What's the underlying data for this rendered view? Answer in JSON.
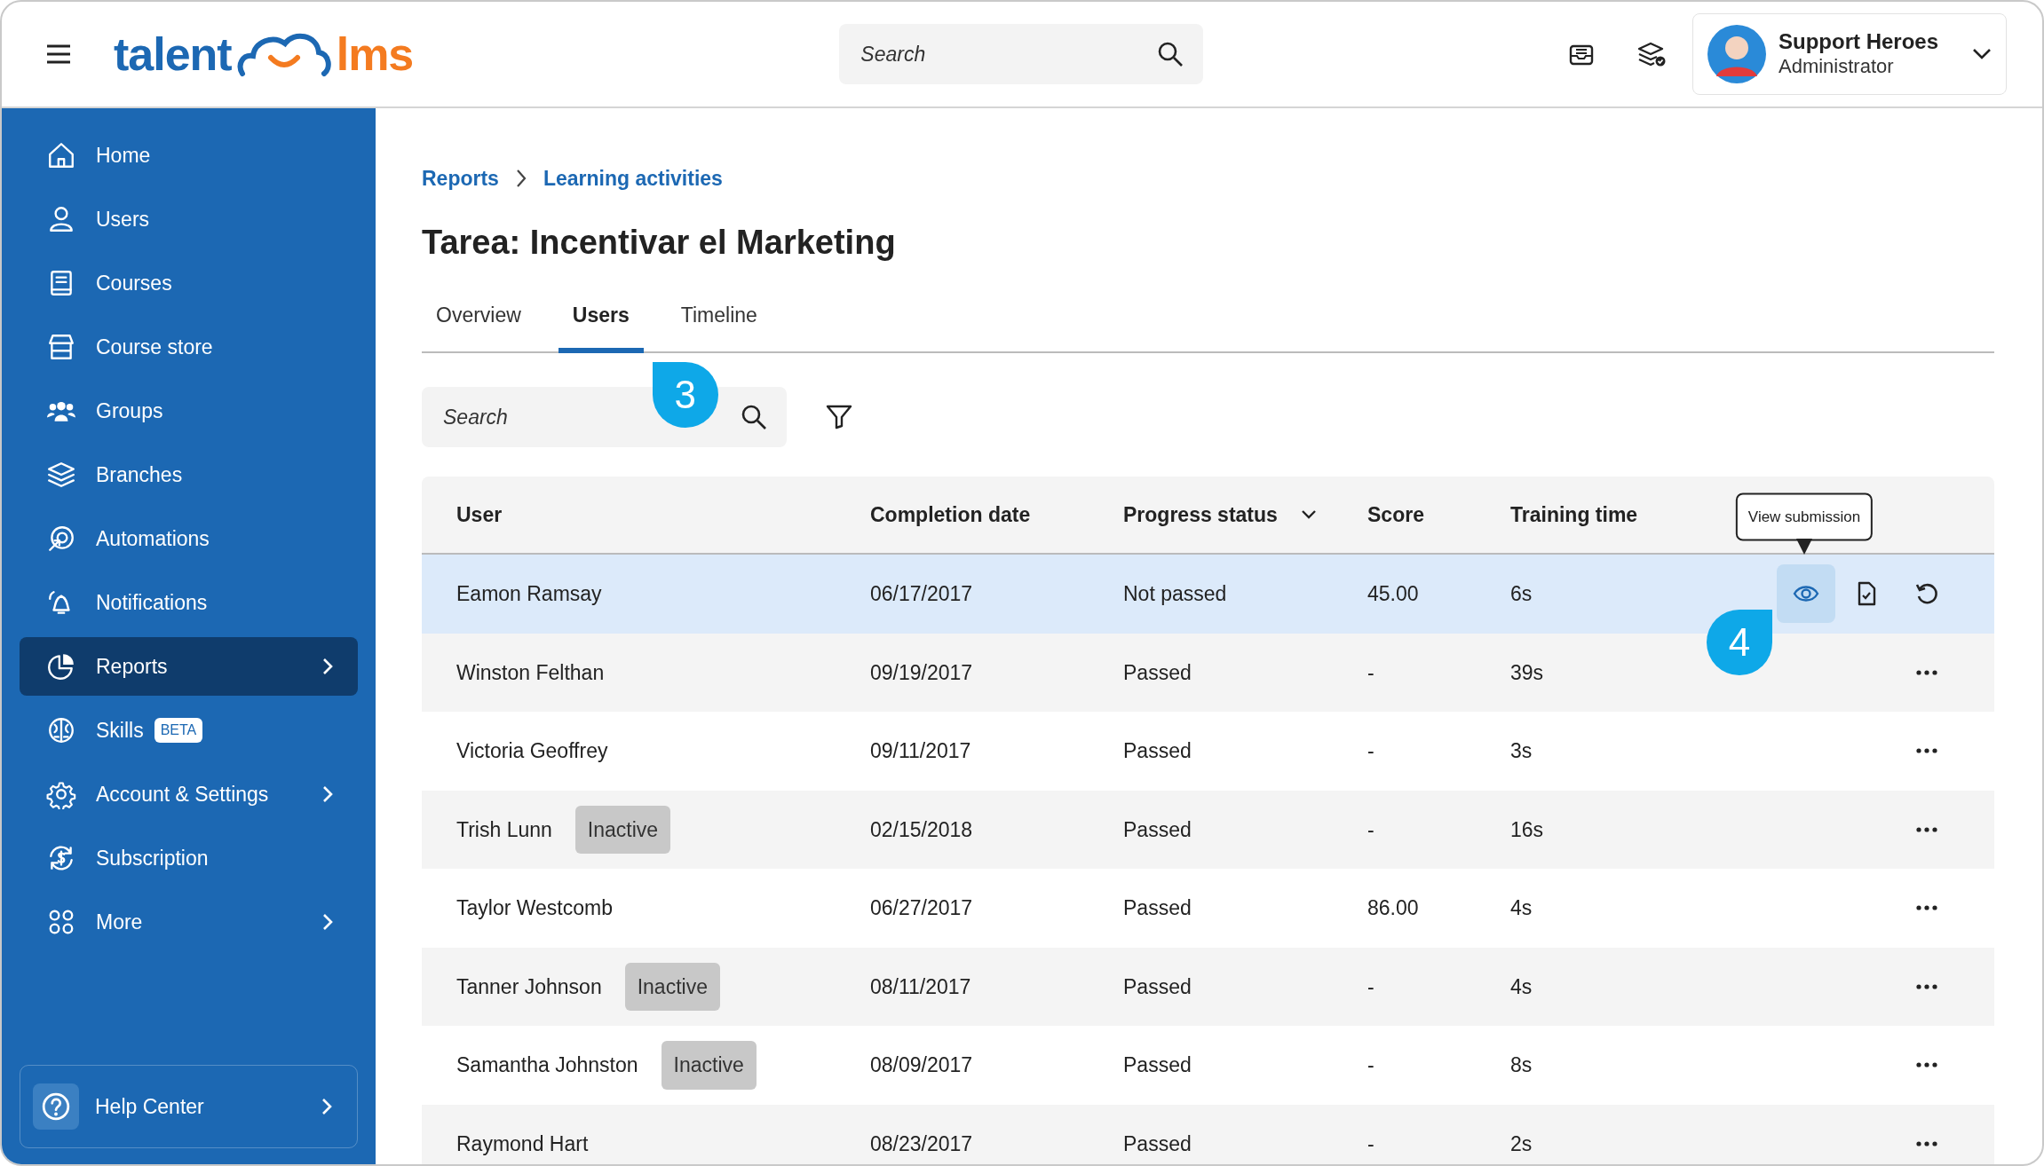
{
  "header": {
    "logo": {
      "left": "talent",
      "right": "lms"
    },
    "search": {
      "placeholder": "Search"
    },
    "user": {
      "name": "Support Heroes",
      "role": "Administrator"
    }
  },
  "sidebar": {
    "items": [
      {
        "label": "Home",
        "selected": false,
        "submenu": false
      },
      {
        "label": "Users",
        "selected": false,
        "submenu": false
      },
      {
        "label": "Courses",
        "selected": false,
        "submenu": false
      },
      {
        "label": "Course store",
        "selected": false,
        "submenu": false
      },
      {
        "label": "Groups",
        "selected": false,
        "submenu": false
      },
      {
        "label": "Branches",
        "selected": false,
        "submenu": false
      },
      {
        "label": "Automations",
        "selected": false,
        "submenu": false
      },
      {
        "label": "Notifications",
        "selected": false,
        "submenu": false
      },
      {
        "label": "Reports",
        "selected": true,
        "submenu": true
      },
      {
        "label": "Skills",
        "badge": "BETA",
        "selected": false,
        "submenu": false
      },
      {
        "label": "Account & Settings",
        "selected": false,
        "submenu": true
      },
      {
        "label": "Subscription",
        "selected": false,
        "submenu": false
      },
      {
        "label": "More",
        "selected": false,
        "submenu": true
      }
    ],
    "help": {
      "label": "Help Center",
      "submenu": true
    }
  },
  "breadcrumb": [
    "Reports",
    "Learning activities"
  ],
  "title": "Tarea: Incentivar el Marketing",
  "tabs": [
    {
      "label": "Overview",
      "selected": false
    },
    {
      "label": "Users",
      "selected": true,
      "callout": "3"
    },
    {
      "label": "Timeline",
      "selected": false
    }
  ],
  "search": {
    "placeholder": "Search"
  },
  "table": {
    "columns": [
      {
        "label": "User",
        "sorted": false
      },
      {
        "label": "Completion date",
        "sorted": false
      },
      {
        "label": "Progress status",
        "sorted": true
      },
      {
        "label": "Score",
        "sorted": false
      },
      {
        "label": "Training time",
        "sorted": false
      }
    ],
    "rows": [
      {
        "user": "Eamon Ramsay",
        "completion_date": "06/17/2017",
        "progress_status": "Not passed",
        "score": "45.00",
        "training_time": "6s",
        "selected": true,
        "tooltip": "View submission",
        "callout": "4"
      },
      {
        "user": "Winston Felthan",
        "completion_date": "09/19/2017",
        "progress_status": "Passed",
        "score": "-",
        "training_time": "39s",
        "selected": false
      },
      {
        "user": "Victoria Geoffrey",
        "completion_date": "09/11/2017",
        "progress_status": "Passed",
        "score": "-",
        "training_time": "3s",
        "selected": false
      },
      {
        "user": "Trish Lunn",
        "badge": "Inactive",
        "completion_date": "02/15/2018",
        "progress_status": "Passed",
        "score": "-",
        "training_time": "16s",
        "selected": false
      },
      {
        "user": "Taylor Westcomb",
        "completion_date": "06/27/2017",
        "progress_status": "Passed",
        "score": "86.00",
        "training_time": "4s",
        "selected": false
      },
      {
        "user": "Tanner Johnson",
        "badge": "Inactive",
        "completion_date": "08/11/2017",
        "progress_status": "Passed",
        "score": "-",
        "training_time": "4s",
        "selected": false
      },
      {
        "user": "Samantha Johnston",
        "badge": "Inactive",
        "completion_date": "08/09/2017",
        "progress_status": "Passed",
        "score": "-",
        "training_time": "8s",
        "selected": false
      },
      {
        "user": "Raymond Hart",
        "completion_date": "08/23/2017",
        "progress_status": "Passed",
        "score": "-",
        "training_time": "2s",
        "selected": false
      }
    ]
  }
}
